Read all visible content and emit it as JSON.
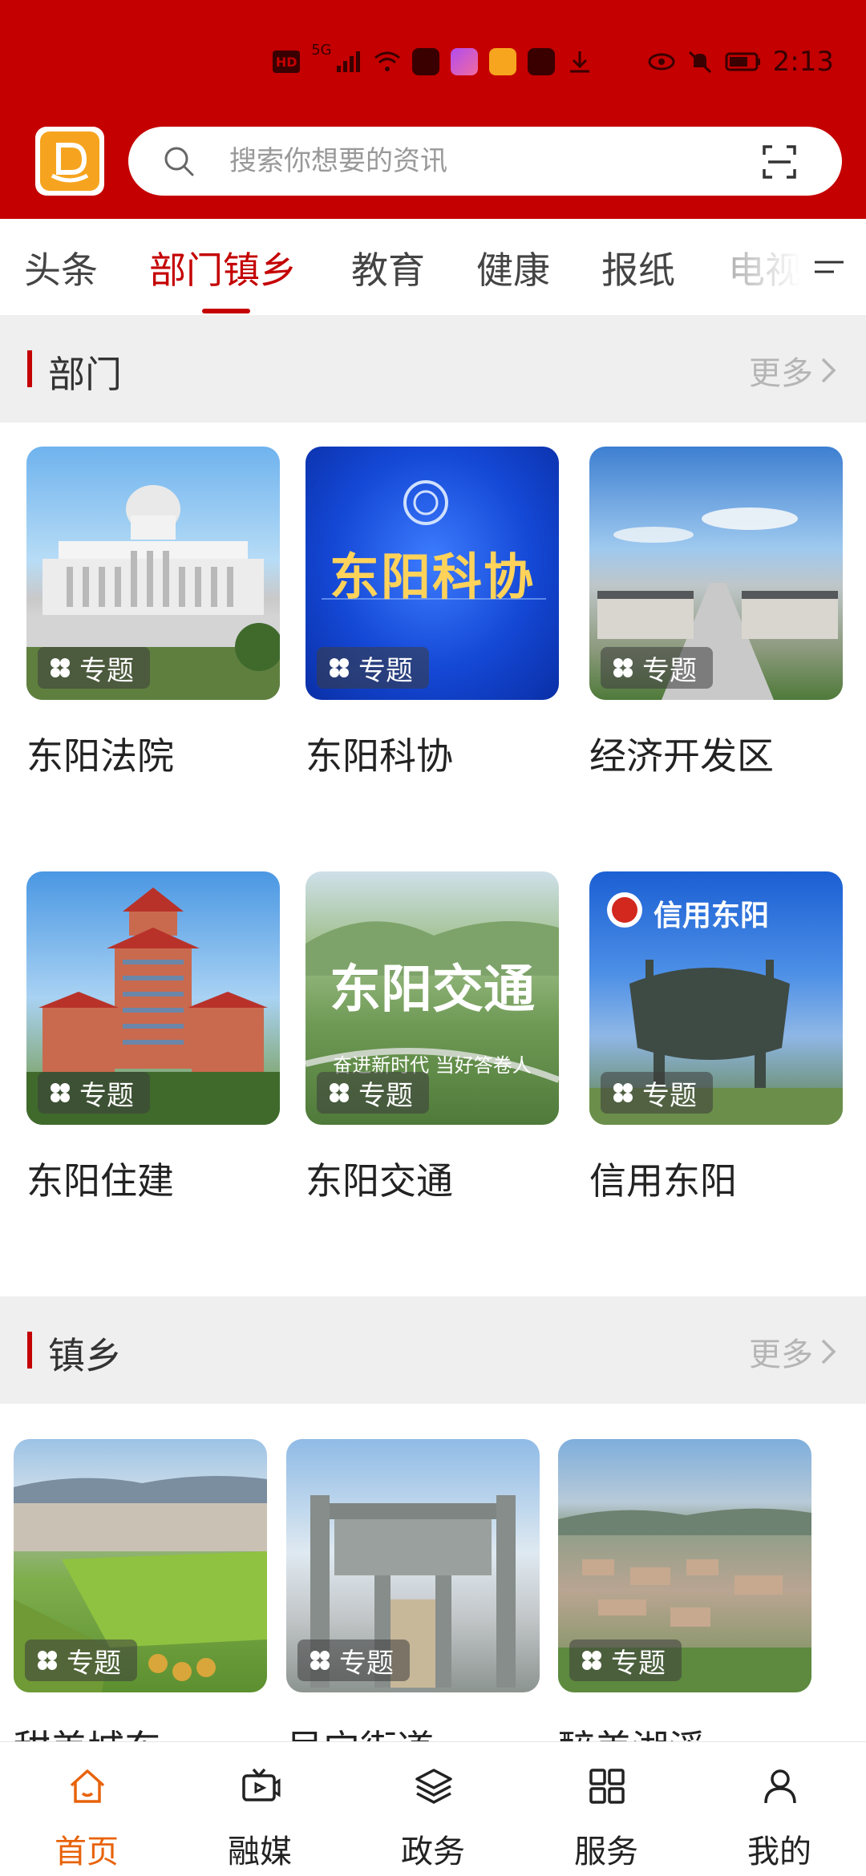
{
  "status": {
    "time": "2:13",
    "hd": "HD",
    "signal": "5G"
  },
  "search": {
    "placeholder": "搜索你想要的资讯"
  },
  "tabs": [
    {
      "label": "头条"
    },
    {
      "label": "部门镇乡"
    },
    {
      "label": "教育"
    },
    {
      "label": "健康"
    },
    {
      "label": "报纸"
    },
    {
      "label": "电视"
    }
  ],
  "sections": [
    {
      "title": "部门",
      "more": "更多",
      "cards": [
        {
          "badge": "专题",
          "title": "东阳法院",
          "image": "courthouse-building"
        },
        {
          "badge": "专题",
          "title": "东阳科协",
          "image": "science-association-banner",
          "banner_text": "东阳科协"
        },
        {
          "badge": "专题",
          "title": "经济开发区",
          "image": "development-zone-aerial"
        },
        {
          "badge": "专题",
          "title": "东阳住建",
          "image": "pagoda-building"
        },
        {
          "badge": "专题",
          "title": "东阳交通",
          "image": "transport-landscape",
          "banner_text": "东阳交通",
          "sub_text": "奋进新时代 当好答卷人"
        },
        {
          "badge": "专题",
          "title": "信用东阳",
          "image": "bronze-cauldron",
          "banner_text": "信用东阳"
        }
      ]
    },
    {
      "title": "镇乡",
      "more": "更多",
      "cards": [
        {
          "badge": "专题",
          "title": "甜美城东",
          "image": "farmland-aerial"
        },
        {
          "badge": "专题",
          "title": "吴宁街道",
          "image": "stone-archway"
        },
        {
          "badge": "专题",
          "title": "醉美湖溪",
          "image": "town-aerial"
        }
      ]
    }
  ],
  "nav": [
    {
      "label": "首页",
      "icon": "home-icon",
      "active": true
    },
    {
      "label": "融媒",
      "icon": "tv-icon"
    },
    {
      "label": "政务",
      "icon": "layers-icon"
    },
    {
      "label": "服务",
      "icon": "grid-icon"
    },
    {
      "label": "我的",
      "icon": "user-icon"
    }
  ],
  "colors": {
    "brand": "#c40000",
    "nav_active": "#e8630a"
  }
}
